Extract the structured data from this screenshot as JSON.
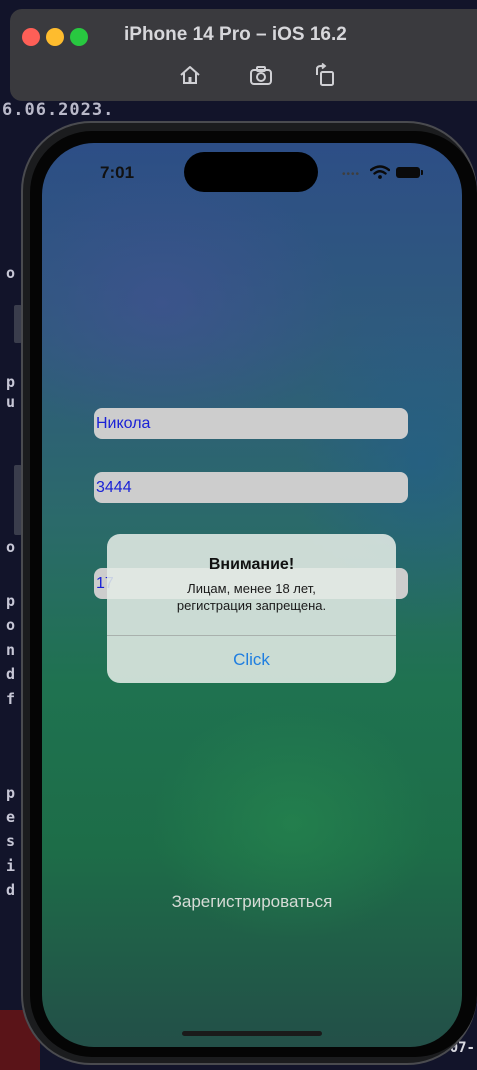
{
  "simulator": {
    "title": "iPhone 14 Pro – iOS 16.2",
    "toolbar_icons": [
      "home-icon",
      "screenshot-icon",
      "rotate-icon"
    ]
  },
  "background": {
    "date_fragment": "6.06.2023.",
    "code_chars": [
      "o",
      "p",
      "u",
      "o",
      "p",
      "o",
      "n",
      "d",
      "f",
      "p",
      "e",
      "s",
      "i",
      "d"
    ],
    "right_fragment": "07-"
  },
  "status_bar": {
    "time": "7:01",
    "icons": [
      "wifi-icon",
      "battery-icon"
    ]
  },
  "form": {
    "name_value": "Никола",
    "second_value": "3444",
    "third_value": "17",
    "register_label": "Зарегистрироваться"
  },
  "alert": {
    "title": "Внимание!",
    "message_line1": "Лицам, менее 18 лет,",
    "message_line2": "регистрация запрещена.",
    "button_label": "Click"
  },
  "colors": {
    "field_text": "#1a22d6",
    "alert_button": "#1f7ee0",
    "field_bg": "#cdcdcd"
  }
}
